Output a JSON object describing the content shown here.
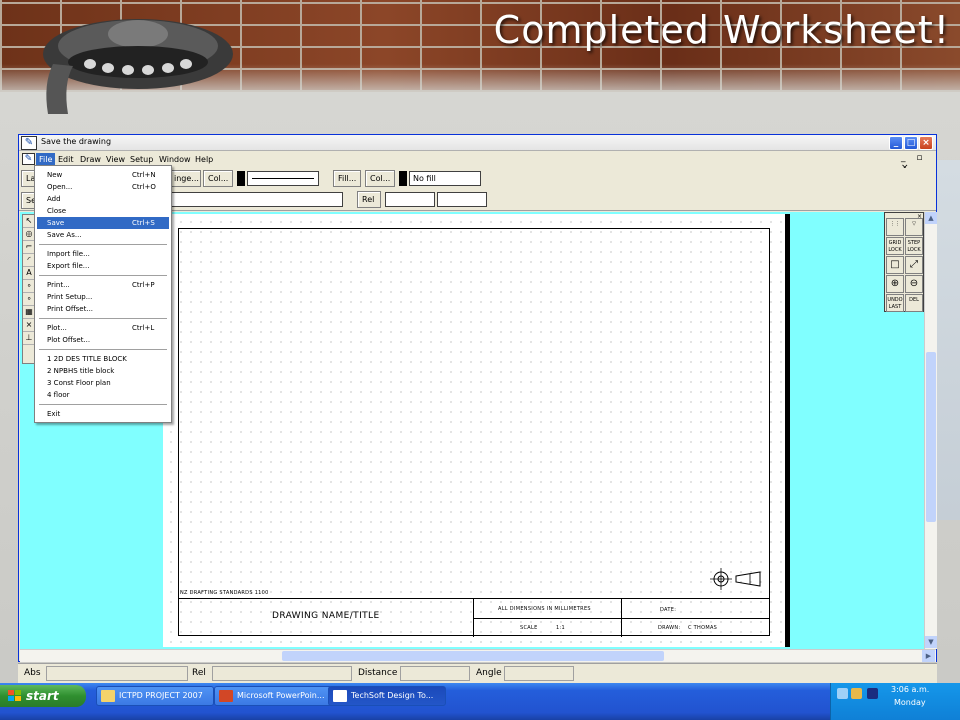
{
  "slide": {
    "title": "Completed Worksheet!"
  },
  "window": {
    "title": "Save the drawing",
    "controls": [
      "_",
      "□",
      "×"
    ],
    "mdi_controls": "_ ▫ ×"
  },
  "menubar": {
    "items": [
      "File",
      "Edit",
      "Draw",
      "View",
      "Setup",
      "Window",
      "Help"
    ],
    "selected": "File"
  },
  "toolbar": {
    "row1": {
      "la": "La",
      "hinge": "inge...",
      "col_line": "Col...",
      "fill": "Fill...",
      "col_fill": "Col...",
      "fill_value": "No fill"
    },
    "row2": {
      "se": "Se",
      "rel": "Rel"
    }
  },
  "file_menu": {
    "items": [
      {
        "label": "New",
        "shortcut": "Ctrl+N"
      },
      {
        "label": "Open...",
        "shortcut": "Ctrl+O"
      },
      {
        "label": "Add",
        "shortcut": ""
      },
      {
        "label": "Close",
        "shortcut": ""
      },
      {
        "label": "Save",
        "shortcut": "Ctrl+S",
        "highlighted": true
      },
      {
        "label": "Save As...",
        "shortcut": ""
      },
      {
        "label": "Import file...",
        "shortcut": ""
      },
      {
        "label": "Export file...",
        "shortcut": ""
      },
      {
        "label": "Print...",
        "shortcut": "Ctrl+P"
      },
      {
        "label": "Print Setup...",
        "shortcut": ""
      },
      {
        "label": "Print Offset...",
        "shortcut": ""
      },
      {
        "label": "Plot...",
        "shortcut": "Ctrl+L"
      },
      {
        "label": "Plot Offset...",
        "shortcut": ""
      },
      {
        "label": "1 2D DES TITLE BLOCK",
        "shortcut": ""
      },
      {
        "label": "2 NPBHS title block",
        "shortcut": ""
      },
      {
        "label": "3 Const Floor plan",
        "shortcut": ""
      },
      {
        "label": "4 floor",
        "shortcut": ""
      },
      {
        "label": "Exit",
        "shortcut": ""
      }
    ]
  },
  "title_block": {
    "standards": "NZ DRAFTING STANDARDS 1100",
    "drawing_name": "DRAWING NAME/TITLE",
    "dimensions": "ALL DIMENSIONS IN MILLIMETRES",
    "date_label": "DATE:",
    "scale_label": "SCALE",
    "scale_value": "1:1",
    "drawn_label": "DRAWN:",
    "drawn_value": "C THOMAS"
  },
  "right_palette": {
    "grid_lock": "GRID\nLOCK",
    "step_lock": "STEP\nLOCK",
    "undo_last": "UNDO\nLAST",
    "del": "DEL"
  },
  "status_bar": {
    "abs": "Abs",
    "rel": "Rel",
    "distance": "Distance",
    "angle": "Angle"
  },
  "taskbar": {
    "start": "start",
    "tasks": [
      {
        "label": "ICTPD PROJECT 2007",
        "icon": "folder-icon"
      },
      {
        "label": "Microsoft PowerPoin...",
        "icon": "powerpoint-icon"
      },
      {
        "label": "TechSoft Design To...",
        "icon": "techsoft-icon",
        "active": true
      }
    ],
    "clock": "3:06 a.m.",
    "day": "Monday"
  },
  "colors": {
    "canvas": "#80ffff",
    "menu_highlight": "#316ac5",
    "taskbar": "#245edb",
    "start_green": "#2f8f2f"
  }
}
